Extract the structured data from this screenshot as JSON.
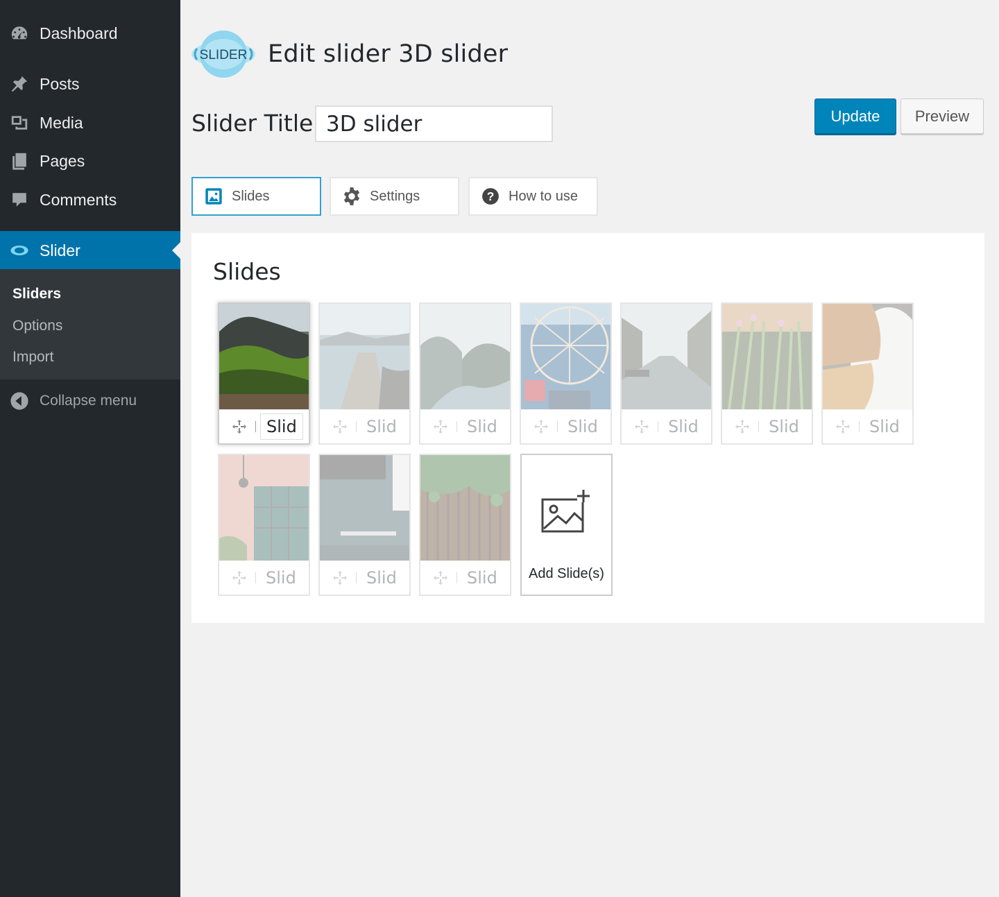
{
  "sidebar": {
    "items": [
      {
        "label": "Dashboard",
        "icon": "dashboard-icon"
      },
      {
        "label": "Posts",
        "icon": "pin-icon"
      },
      {
        "label": "Media",
        "icon": "media-icon"
      },
      {
        "label": "Pages",
        "icon": "pages-icon"
      },
      {
        "label": "Comments",
        "icon": "comment-icon"
      },
      {
        "label": "Slider",
        "icon": "slider-icon"
      }
    ],
    "submenu": [
      "Sliders",
      "Options",
      "Import"
    ],
    "collapse_label": "Collapse menu"
  },
  "header": {
    "logo_text": "SLIDER",
    "title": "Edit slider 3D slider",
    "slider_title_label": "Slider Title",
    "slider_title_value": "3D slider",
    "update_label": "Update",
    "preview_label": "Preview"
  },
  "tabs": [
    {
      "label": "Slides",
      "icon": "image-icon"
    },
    {
      "label": "Settings",
      "icon": "gear-icon"
    },
    {
      "label": "How to use",
      "icon": "question-icon"
    }
  ],
  "panel": {
    "title": "Slides",
    "slide_label": "Slid",
    "add_label": "Add Slide(s)",
    "slides": [
      "mountain-moss",
      "lake-pier",
      "fjord",
      "crab-trap",
      "canal",
      "chives",
      "bread",
      "brick-window",
      "grey-wall",
      "vines-wood"
    ]
  },
  "colors": {
    "sidebar_bg": "#23282d",
    "accent": "#0073aa",
    "button_primary": "#0085ba",
    "tab_active_border": "#33a1d0"
  }
}
